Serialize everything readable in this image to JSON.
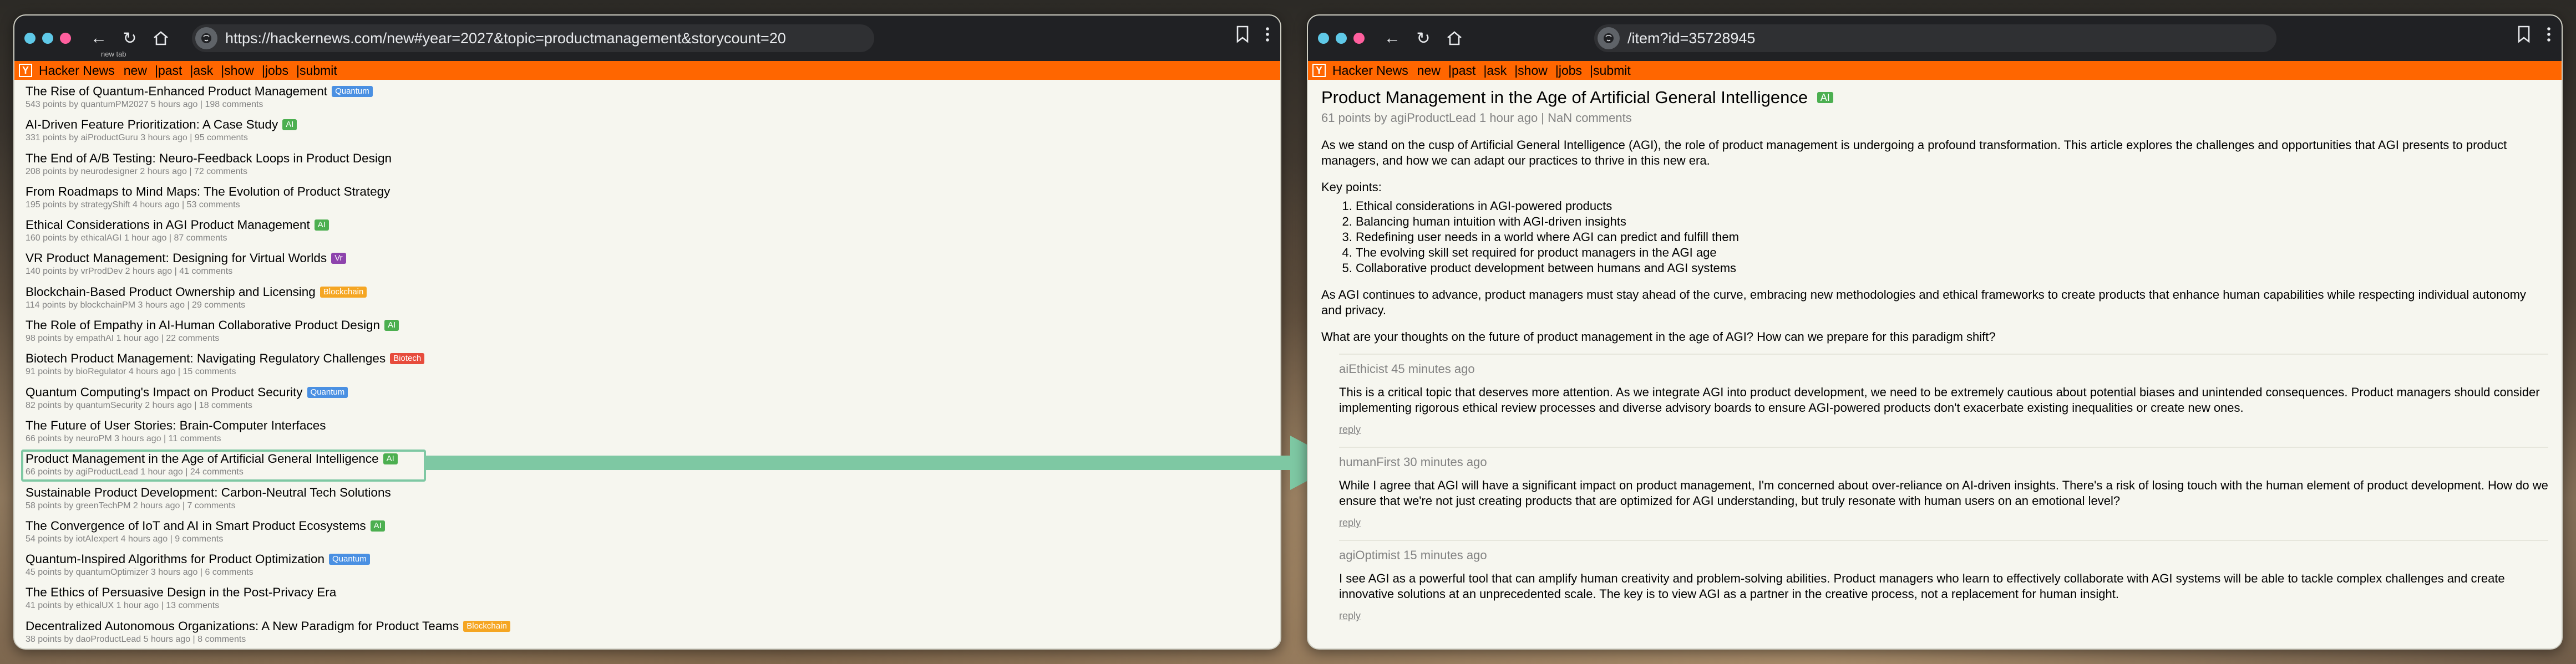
{
  "colors": {
    "hn_orange": "#ff6600",
    "highlight": "#7ec8a3",
    "tag_quantum": "#4a90e2",
    "tag_ai": "#4caf50",
    "tag_vr": "#8e44ad",
    "tag_blockchain": "#f5a623",
    "tag_biotech": "#e74c3c"
  },
  "left_window": {
    "url": "https://hackernews.com/new#year=2027&topic=productmanagement&storycount=20",
    "new_tab_tooltip": "new tab"
  },
  "right_window": {
    "url": "/item?id=35728945"
  },
  "nav": {
    "logo": "Y",
    "brand": "Hacker News",
    "links": [
      "new",
      "|past",
      "|ask",
      "|show",
      "|jobs",
      "|submit"
    ]
  },
  "stories": [
    {
      "title": "The Rise of Quantum-Enhanced Product Management",
      "tag": "Quantum",
      "tag_color": "#4a90e2",
      "meta": "543 points by quantumPM2027 5 hours ago | 198 comments"
    },
    {
      "title": "AI-Driven Feature Prioritization: A Case Study",
      "tag": "AI",
      "tag_color": "#4caf50",
      "meta": "331 points by aiProductGuru 3 hours ago | 95 comments"
    },
    {
      "title": "The End of A/B Testing: Neuro-Feedback Loops in Product Design",
      "tag": "",
      "tag_color": "",
      "meta": "208 points by neurodesigner 2 hours ago | 72 comments"
    },
    {
      "title": "From Roadmaps to Mind Maps: The Evolution of Product Strategy",
      "tag": "",
      "tag_color": "",
      "meta": "195 points by strategyShift 4 hours ago | 53 comments"
    },
    {
      "title": "Ethical Considerations in AGI Product Management",
      "tag": "AI",
      "tag_color": "#4caf50",
      "meta": "160 points by ethicalAGI 1 hour ago | 87 comments"
    },
    {
      "title": "VR Product Management: Designing for Virtual Worlds",
      "tag": "Vr",
      "tag_color": "#8e44ad",
      "meta": "140 points by vrProdDev 2 hours ago | 41 comments"
    },
    {
      "title": "Blockchain-Based Product Ownership and Licensing",
      "tag": "Blockchain",
      "tag_color": "#f5a623",
      "meta": "114 points by blockchainPM 3 hours ago | 29 comments"
    },
    {
      "title": "The Role of Empathy in AI-Human Collaborative Product Design",
      "tag": "AI",
      "tag_color": "#4caf50",
      "meta": "98 points by empathAI 1 hour ago | 22 comments"
    },
    {
      "title": "Biotech Product Management: Navigating Regulatory Challenges",
      "tag": "Biotech",
      "tag_color": "#e74c3c",
      "meta": "91 points by bioRegulator 4 hours ago | 15 comments"
    },
    {
      "title": "Quantum Computing's Impact on Product Security",
      "tag": "Quantum",
      "tag_color": "#4a90e2",
      "meta": "82 points by quantumSecurity 2 hours ago | 18 comments"
    },
    {
      "title": "The Future of User Stories: Brain-Computer Interfaces",
      "tag": "",
      "tag_color": "",
      "meta": "66 points by neuroPM 3 hours ago | 11 comments"
    },
    {
      "title": "Product Management in the Age of Artificial General Intelligence",
      "tag": "AI",
      "tag_color": "#4caf50",
      "meta": "66 points by agiProductLead 1 hour ago | 24 comments",
      "highlighted": true
    },
    {
      "title": "Sustainable Product Development: Carbon-Neutral Tech Solutions",
      "tag": "",
      "tag_color": "",
      "meta": "58 points by greenTechPM 2 hours ago | 7 comments"
    },
    {
      "title": "The Convergence of IoT and AI in Smart Product Ecosystems",
      "tag": "AI",
      "tag_color": "#4caf50",
      "meta": "54 points by iotAIexpert 4 hours ago | 9 comments"
    },
    {
      "title": "Quantum-Inspired Algorithms for Product Optimization",
      "tag": "Quantum",
      "tag_color": "#4a90e2",
      "meta": "45 points by quantumOptimizer 3 hours ago | 6 comments"
    },
    {
      "title": "The Ethics of Persuasive Design in the Post-Privacy Era",
      "tag": "",
      "tag_color": "",
      "meta": "41 points by ethicalUX 1 hour ago | 13 comments"
    },
    {
      "title": "Decentralized Autonomous Organizations: A New Paradigm for Product Teams",
      "tag": "Blockchain",
      "tag_color": "#f5a623",
      "meta": "38 points by daoProductLead 5 hours ago | 8 comments"
    }
  ],
  "article": {
    "title": "Product Management in the Age of Artificial General Intelligence",
    "tag": "AI",
    "meta": "61 points by agiProductLead 1 hour ago | NaN comments",
    "intro": "As we stand on the cusp of Artificial General Intelligence (AGI), the role of product management is undergoing a profound transformation. This article explores the challenges and opportunities that AGI presents to product managers, and how we can adapt our practices to thrive in this new era.",
    "key_points_label": "Key points:",
    "key_points": [
      "Ethical considerations in AGI-powered products",
      "Balancing human intuition with AGI-driven insights",
      "Redefining user needs in a world where AGI can predict and fulfill them",
      "The evolving skill set required for product managers in the AGI age",
      "Collaborative product development between humans and AGI systems"
    ],
    "conclusion": "As AGI continues to advance, product managers must stay ahead of the curve, embracing new methodologies and ethical frameworks to create products that enhance human capabilities while respecting individual autonomy and privacy.",
    "question": "What are your thoughts on the future of product management in the age of AGI? How can we prepare for this paradigm shift?"
  },
  "comments": [
    {
      "user": "aiEthicist",
      "time": "45 minutes ago",
      "text": "This is a critical topic that deserves more attention. As we integrate AGI into product development, we need to be extremely cautious about potential biases and unintended consequences. Product managers should consider implementing rigorous ethical review processes and diverse advisory boards to ensure AGI-powered products don't exacerbate existing inequalities or create new ones.",
      "reply": "reply"
    },
    {
      "user": "humanFirst",
      "time": "30 minutes ago",
      "text": "While I agree that AGI will have a significant impact on product management, I'm concerned about over-reliance on AI-driven insights. There's a risk of losing touch with the human element of product development. How do we ensure that we're not just creating products that are optimized for AGI understanding, but truly resonate with human users on an emotional level?",
      "reply": "reply"
    },
    {
      "user": "agiOptimist",
      "time": "15 minutes ago",
      "text": "I see AGI as a powerful tool that can amplify human creativity and problem-solving abilities. Product managers who learn to effectively collaborate with AGI systems will be able to tackle complex challenges and create innovative solutions at an unprecedented scale. The key is to view AGI as a partner in the creative process, not a replacement for human insight.",
      "reply": "reply"
    }
  ]
}
